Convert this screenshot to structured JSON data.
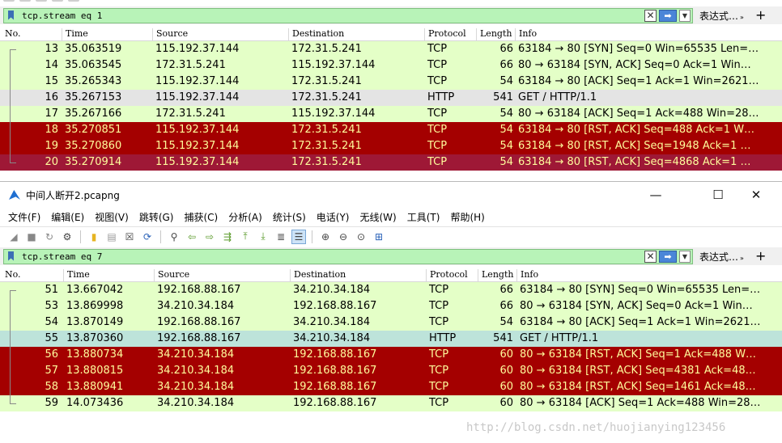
{
  "top_pane": {
    "filter": {
      "value": "tcp.stream eq 1"
    },
    "expression_label": "表达式…",
    "plus_label": "+",
    "columns": [
      "No.",
      "Time",
      "Source",
      "Destination",
      "Protocol",
      "Length",
      "Info"
    ],
    "rows": [
      {
        "no": "13",
        "time": "35.063519",
        "source": "115.192.37.144",
        "destination": "172.31.5.241",
        "protocol": "TCP",
        "length": "66",
        "info": "63184 → 80 [SYN] Seq=0 Win=65535 Len=…",
        "style": "green"
      },
      {
        "no": "14",
        "time": "35.063545",
        "source": "172.31.5.241",
        "destination": "115.192.37.144",
        "protocol": "TCP",
        "length": "66",
        "info": "80 → 63184 [SYN, ACK] Seq=0 Ack=1 Win…",
        "style": "green"
      },
      {
        "no": "15",
        "time": "35.265343",
        "source": "115.192.37.144",
        "destination": "172.31.5.241",
        "protocol": "TCP",
        "length": "54",
        "info": "63184 → 80 [ACK] Seq=1 Ack=1 Win=2621…",
        "style": "green"
      },
      {
        "no": "16",
        "time": "35.267153",
        "source": "115.192.37.144",
        "destination": "172.31.5.241",
        "protocol": "HTTP",
        "length": "541",
        "info": "GET / HTTP/1.1",
        "style": "http"
      },
      {
        "no": "17",
        "time": "35.267166",
        "source": "172.31.5.241",
        "destination": "115.192.37.144",
        "protocol": "TCP",
        "length": "54",
        "info": "80 → 63184 [ACK] Seq=1 Ack=488 Win=28…",
        "style": "green"
      },
      {
        "no": "18",
        "time": "35.270851",
        "source": "115.192.37.144",
        "destination": "172.31.5.241",
        "protocol": "TCP",
        "length": "54",
        "info": "63184 → 80 [RST, ACK] Seq=488 Ack=1 W…",
        "style": "red"
      },
      {
        "no": "19",
        "time": "35.270860",
        "source": "115.192.37.144",
        "destination": "172.31.5.241",
        "protocol": "TCP",
        "length": "54",
        "info": "63184 → 80 [RST, ACK] Seq=1948 Ack=1 …",
        "style": "red"
      },
      {
        "no": "20",
        "time": "35.270914",
        "source": "115.192.37.144",
        "destination": "172.31.5.241",
        "protocol": "TCP",
        "length": "54",
        "info": "63184 → 80 [RST, ACK] Seq=4868 Ack=1 …",
        "style": "selected"
      }
    ]
  },
  "window": {
    "title": "中间人断开2.pcapng",
    "minimize": "—",
    "maximize": "☐",
    "close": "✕",
    "menu": [
      "文件(F)",
      "编辑(E)",
      "视图(V)",
      "跳转(G)",
      "捕获(C)",
      "分析(A)",
      "统计(S)",
      "电话(Y)",
      "无线(W)",
      "工具(T)",
      "帮助(H)"
    ]
  },
  "bottom_pane": {
    "filter": {
      "value": "tcp.stream eq 7"
    },
    "expression_label": "表达式…",
    "plus_label": "+",
    "columns": [
      "No.",
      "Time",
      "Source",
      "Destination",
      "Protocol",
      "Length",
      "Info"
    ],
    "rows": [
      {
        "no": "51",
        "time": "13.667042",
        "source": "192.168.88.167",
        "destination": "34.210.34.184",
        "protocol": "TCP",
        "length": "66",
        "info": "63184 → 80 [SYN] Seq=0 Win=65535 Len=…",
        "style": "green"
      },
      {
        "no": "53",
        "time": "13.869998",
        "source": "34.210.34.184",
        "destination": "192.168.88.167",
        "protocol": "TCP",
        "length": "66",
        "info": "80 → 63184 [SYN, ACK] Seq=0 Ack=1 Win…",
        "style": "green"
      },
      {
        "no": "54",
        "time": "13.870149",
        "source": "192.168.88.167",
        "destination": "34.210.34.184",
        "protocol": "TCP",
        "length": "54",
        "info": "63184 → 80 [ACK] Seq=1 Ack=1 Win=2621…",
        "style": "green"
      },
      {
        "no": "55",
        "time": "13.870360",
        "source": "192.168.88.167",
        "destination": "34.210.34.184",
        "protocol": "HTTP",
        "length": "541",
        "info": "GET / HTTP/1.1",
        "style": "http2"
      },
      {
        "no": "56",
        "time": "13.880734",
        "source": "34.210.34.184",
        "destination": "192.168.88.167",
        "protocol": "TCP",
        "length": "60",
        "info": "80 → 63184 [RST, ACK] Seq=1 Ack=488 W…",
        "style": "red"
      },
      {
        "no": "57",
        "time": "13.880815",
        "source": "34.210.34.184",
        "destination": "192.168.88.167",
        "protocol": "TCP",
        "length": "60",
        "info": "80 → 63184 [RST, ACK] Seq=4381 Ack=48…",
        "style": "red"
      },
      {
        "no": "58",
        "time": "13.880941",
        "source": "34.210.34.184",
        "destination": "192.168.88.167",
        "protocol": "TCP",
        "length": "60",
        "info": "80 → 63184 [RST, ACK] Seq=1461 Ack=48…",
        "style": "red"
      },
      {
        "no": "59",
        "time": "14.073436",
        "source": "34.210.34.184",
        "destination": "192.168.88.167",
        "protocol": "TCP",
        "length": "60",
        "info": "80 → 63184 [ACK] Seq=1 Ack=488 Win=28…",
        "style": "green"
      }
    ]
  },
  "watermark": "http://blog.csdn.net/huojianying123456",
  "toolbar_icons": [
    "shark-fin-start-icon",
    "stop-icon",
    "restart-icon",
    "options-gear-icon",
    "open-folder-icon",
    "save-file-icon",
    "close-file-icon",
    "reload-icon",
    "find-packet-icon",
    "go-back-icon",
    "go-forward-icon",
    "go-to-packet-icon",
    "go-first-icon",
    "go-last-icon",
    "auto-scroll-icon",
    "colorize-icon",
    "zoom-in-icon",
    "zoom-out-icon",
    "zoom-normal-icon",
    "resize-columns-icon"
  ]
}
